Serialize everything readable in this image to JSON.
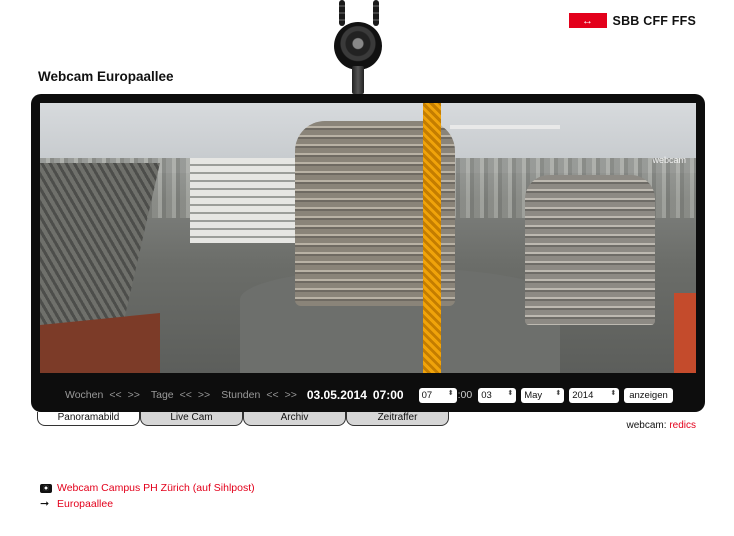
{
  "page": {
    "title": "Webcam Europaallee"
  },
  "logo": {
    "symbol": "↔",
    "text": "SBB CFF FFS",
    "color": "#e3001b"
  },
  "webcam": {
    "watermark": "webcam"
  },
  "controls": {
    "weeks": {
      "label": "Wochen",
      "back": "<<",
      "fwd": ">>"
    },
    "days": {
      "label": "Tage",
      "back": "<<",
      "fwd": ">>"
    },
    "hours": {
      "label": "Stunden",
      "back": "<<",
      "fwd": ">>"
    },
    "date": "03.05.2014",
    "time": "07:00",
    "hour_select": "07",
    "minute_text": ":00",
    "day_select": "03",
    "month_select": "May",
    "year_select": "2014",
    "show_button": "anzeigen"
  },
  "tabs": [
    {
      "label": "Panoramabild",
      "active": true
    },
    {
      "label": "Live Cam",
      "active": false
    },
    {
      "label": "Archiv",
      "active": false
    },
    {
      "label": "Zeitraffer",
      "active": false
    }
  ],
  "credit": {
    "prefix": "webcam:",
    "link": "redics"
  },
  "links": [
    {
      "icon": "camera-icon",
      "text": "Webcam Campus PH Zürich (auf Sihlpost)"
    },
    {
      "icon": "arrow-right-icon",
      "text": "Europaallee"
    }
  ]
}
